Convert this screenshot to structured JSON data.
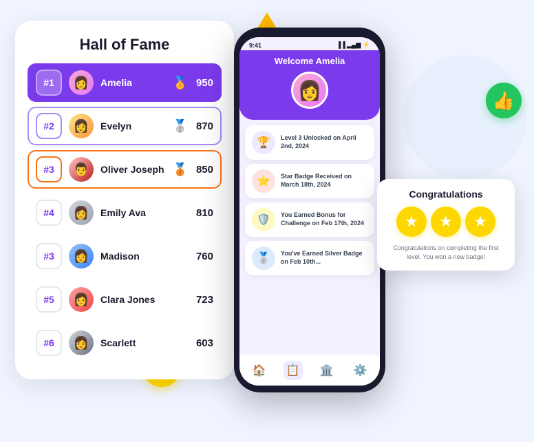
{
  "decorative": {
    "star_unicode": "★",
    "thumbs_unicode": "👍"
  },
  "hall_of_fame": {
    "title": "Hall of Fame",
    "rows": [
      {
        "rank": "#1",
        "name": "Amelia",
        "medal": "🏅",
        "score": "950",
        "rank_class": "rank-1",
        "avatar_class": "avatar-amelia",
        "avatar_emoji": "👩"
      },
      {
        "rank": "#2",
        "name": "Evelyn",
        "medal": "🥈",
        "score": "870",
        "rank_class": "rank-2",
        "avatar_class": "avatar-evelyn",
        "avatar_emoji": "👩"
      },
      {
        "rank": "#3",
        "name": "Oliver Joseph",
        "medal": "🥉",
        "score": "850",
        "rank_class": "rank-3",
        "avatar_class": "avatar-oliver",
        "avatar_emoji": "👨"
      },
      {
        "rank": "#4",
        "name": "Emily Ava",
        "medal": "",
        "score": "810",
        "rank_class": "rank-other",
        "avatar_class": "avatar-emily",
        "avatar_emoji": "👩"
      },
      {
        "rank": "#3",
        "name": "Madison",
        "medal": "",
        "score": "760",
        "rank_class": "rank-other",
        "avatar_class": "avatar-madison",
        "avatar_emoji": "👩"
      },
      {
        "rank": "#5",
        "name": "Clara Jones",
        "medal": "",
        "score": "723",
        "rank_class": "rank-other",
        "avatar_class": "avatar-clara",
        "avatar_emoji": "👩"
      },
      {
        "rank": "#6",
        "name": "Scarlett",
        "medal": "",
        "score": "603",
        "rank_class": "rank-other",
        "avatar_class": "avatar-scarlett",
        "avatar_emoji": "👩"
      }
    ]
  },
  "phone": {
    "status_time": "9:41",
    "welcome": "Welcome Amelia",
    "activities": [
      {
        "text": "Level 3 Unlocked on April 2nd, 2024",
        "icon": "🏆",
        "icon_class": "purple"
      },
      {
        "text": "Star Badge Received on March 18th, 2024",
        "icon": "⭐",
        "icon_class": "red"
      },
      {
        "text": "You Earned Bonus for Challenge on Feb 17th, 2024",
        "icon": "🛡️",
        "icon_class": "yellow"
      },
      {
        "text": "You've Earned Silver Badge on Feb 10th...",
        "icon": "🥈",
        "icon_class": "blue"
      }
    ],
    "nav_items": [
      {
        "icon": "🏠",
        "active": false,
        "name": "home"
      },
      {
        "icon": "📋",
        "active": true,
        "name": "activity"
      },
      {
        "icon": "🏛️",
        "active": false,
        "name": "leaderboard"
      },
      {
        "icon": "⚙️",
        "active": false,
        "name": "settings"
      }
    ]
  },
  "congrats": {
    "title": "Congratulations",
    "stars": [
      "★",
      "★",
      "★"
    ],
    "text": "Congratulations on completing the first level. You won a new badge!"
  }
}
